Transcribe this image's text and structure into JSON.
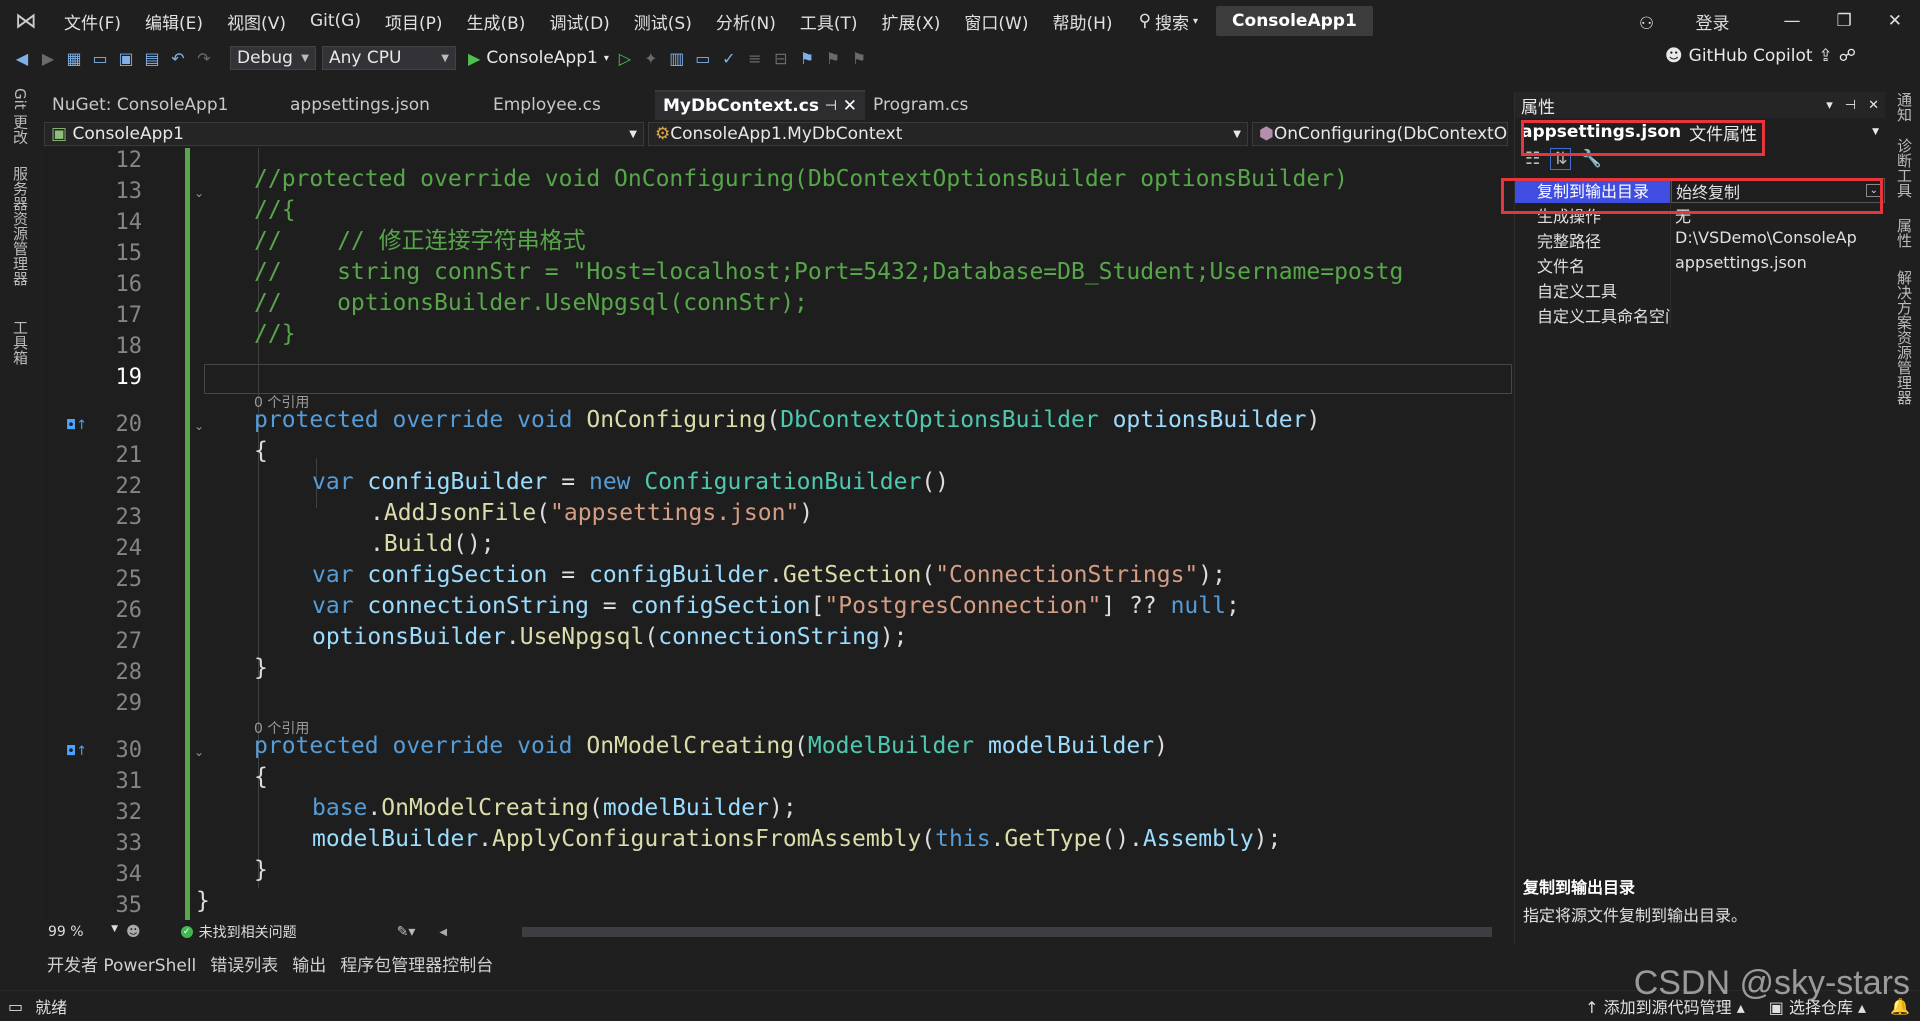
{
  "menu": [
    "文件(F)",
    "编辑(E)",
    "视图(V)",
    "Git(G)",
    "项目(P)",
    "生成(B)",
    "调试(D)",
    "测试(S)",
    "分析(N)",
    "工具(T)",
    "扩展(X)",
    "窗口(W)",
    "帮助(H)"
  ],
  "search_label": "搜索",
  "project_badge": "ConsoleApp1",
  "login": "登录",
  "toolbar": {
    "config": "Debug",
    "platform": "Any CPU",
    "run_target": "ConsoleApp1",
    "copilot": "GitHub Copilot"
  },
  "left_rail": [
    "Git 更改",
    "服务器资源管理器",
    "工具箱"
  ],
  "right_rail": [
    "通知",
    "诊断工具",
    "属性",
    "解决方案资源管理器"
  ],
  "tabs": [
    {
      "label": "NuGet: ConsoleApp1",
      "active": false
    },
    {
      "label": "appsettings.json",
      "active": false
    },
    {
      "label": "Employee.cs",
      "active": false
    },
    {
      "label": "MyDbContext.cs",
      "active": true
    },
    {
      "label": "Program.cs",
      "active": false
    }
  ],
  "nav": {
    "project": "ConsoleApp1",
    "class": "ConsoleApp1.MyDbContext",
    "member": "OnConfiguring(DbContextOp"
  },
  "line_numbers": [
    "12",
    "13",
    "14",
    "15",
    "16",
    "17",
    "18",
    "19",
    "20",
    "21",
    "22",
    "23",
    "24",
    "25",
    "26",
    "27",
    "28",
    "29",
    "30",
    "31",
    "32",
    "33",
    "34",
    "35"
  ],
  "current_line": "19",
  "lens_text": "0 个引用",
  "code": {
    "l13": "//protected override void OnConfiguring(DbContextOptionsBuilder optionsBuilder)",
    "l14": "//{",
    "l15": "//    // 修正连接字符串格式",
    "l16": "//    string connStr = \"Host=localhost;Port=5432;Database=DB_Student;Username=postg",
    "l17": "//    optionsBuilder.UseNpgsql(connStr);",
    "l18": "//}"
  },
  "editor_status": {
    "zoom": "99 %",
    "issues": "未找到相关问题"
  },
  "bottom_tabs": [
    "开发者 PowerShell",
    "错误列表",
    "输出",
    "程序包管理器控制台"
  ],
  "status": {
    "ready": "就绪",
    "add_source": "添加到源代码管理",
    "select_repo": "选择仓库"
  },
  "watermark": "CSDN @sky-stars",
  "properties": {
    "title": "属性",
    "object_name": "appsettings.json",
    "object_type": "文件属性",
    "rows": [
      {
        "key": "复制到输出目录",
        "value": "始终复制",
        "selected": true
      },
      {
        "key": "生成操作",
        "value": "无",
        "selected": false
      },
      {
        "key": "完整路径",
        "value": "D:\\VSDemo\\ConsoleAp",
        "selected": false
      },
      {
        "key": "文件名",
        "value": "appsettings.json",
        "selected": false
      },
      {
        "key": "自定义工具",
        "value": "",
        "selected": false
      },
      {
        "key": "自定义工具命名空间",
        "value": "",
        "selected": false
      }
    ],
    "desc_title": "复制到输出目录",
    "desc_text": "指定将源文件复制到输出目录。"
  },
  "colors": {
    "comment": "#57a64a",
    "keyword": "#569cd6",
    "type": "#4ec9b0",
    "method": "#dcdcaa",
    "identifier": "#9cdcfe",
    "string": "#d69d85",
    "highlight": "#e8353c"
  }
}
